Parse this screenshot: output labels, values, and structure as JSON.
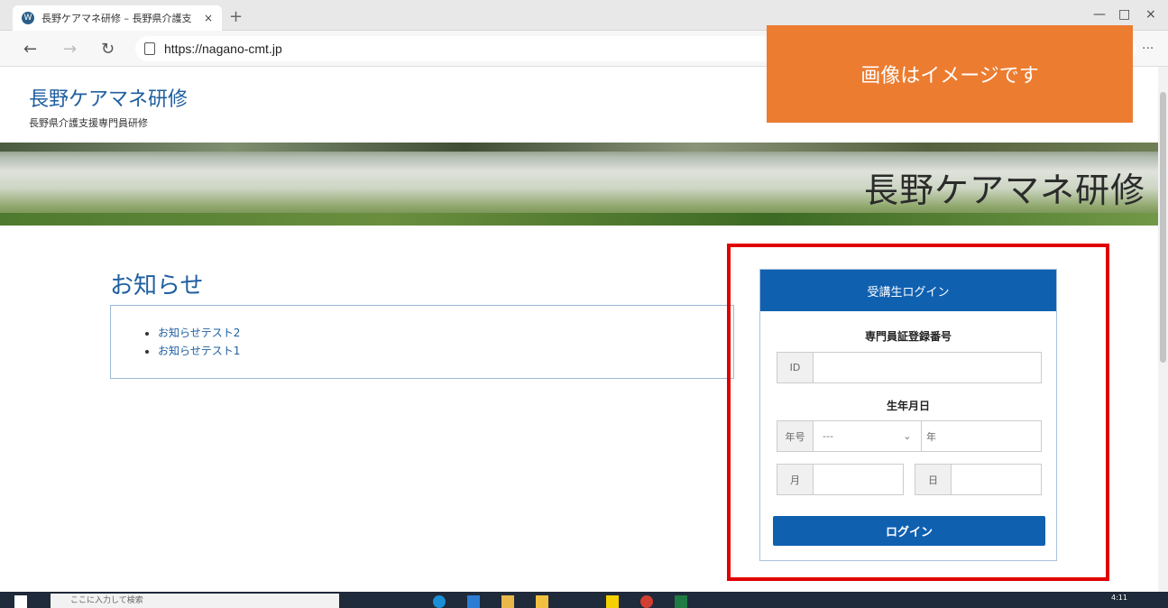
{
  "browser": {
    "tab_title": "長野ケアマネ研修 – 長野県介護支",
    "tab_close": "×",
    "new_tab": "+",
    "minimize": "—",
    "maximize": "□",
    "close": "×",
    "back": "←",
    "forward": "→",
    "reload": "↻",
    "url": "https://nagano-cmt.jp",
    "more": "···"
  },
  "notice_banner": "画像はイメージです",
  "site": {
    "title": "長野ケアマネ研修",
    "subtitle": "長野県介護支援専門員研修",
    "hero_title": "長野ケアマネ研修"
  },
  "news": {
    "heading": "お知らせ",
    "items": [
      {
        "label": "お知らせテスト2"
      },
      {
        "label": "お知らせテスト1"
      }
    ]
  },
  "login": {
    "header": "受講生ログイン",
    "id_section_label": "専門員証登録番号",
    "id_prefix": "ID",
    "dob_section_label": "生年月日",
    "era_prefix": "年号",
    "era_value": "---",
    "year_suffix": "年",
    "month_prefix": "月",
    "day_prefix": "日",
    "button": "ログイン"
  },
  "taskbar": {
    "search_placeholder": "ここに入力して検索",
    "clock": "4:11"
  },
  "colors": {
    "accent": "#1060b0",
    "banner": "#ec7c30",
    "highlight_frame": "#e00000"
  }
}
